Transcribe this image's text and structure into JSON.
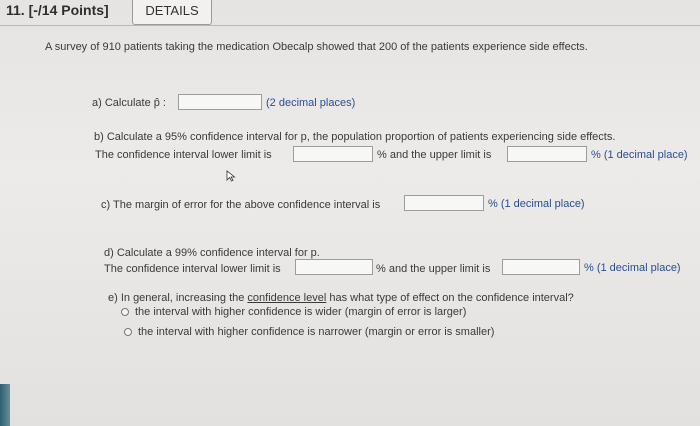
{
  "header": {
    "question_number": "11. [-/14 Points]",
    "details_tab": "DETAILS"
  },
  "intro": "A survey of 910 patients taking the medication Obecalp showed that 200 of the patients experience side effects.",
  "part_a": {
    "label": "a) Calculate p̂ :",
    "hint": "(2 decimal places)",
    "value": ""
  },
  "part_b": {
    "line1": "b) Calculate a 95% confidence interval for p, the population proportion of patients experiencing side effects.",
    "lower_label": "The confidence interval lower limit is",
    "middle_label": "% and the upper limit is",
    "hint": "% (1 decimal place)",
    "lower_value": "",
    "upper_value": ""
  },
  "part_c": {
    "label": "c) The margin of error for the above confidence interval is",
    "hint": "% (1 decimal place)",
    "value": ""
  },
  "part_d": {
    "line1": "d) Calculate a 99% confidence interval for p.",
    "lower_label": "The confidence interval lower limit is",
    "middle_label": "% and the upper limit is",
    "hint": "% (1 decimal place)",
    "lower_value": "",
    "upper_value": ""
  },
  "part_e": {
    "prefix": "e) In general, increasing the ",
    "link": "confidence level",
    "suffix": " has what type of effect on the confidence interval?",
    "options": [
      "the interval with higher confidence is wider (margin of error is larger)",
      "the interval with higher confidence is narrower (margin or error is smaller)"
    ]
  }
}
